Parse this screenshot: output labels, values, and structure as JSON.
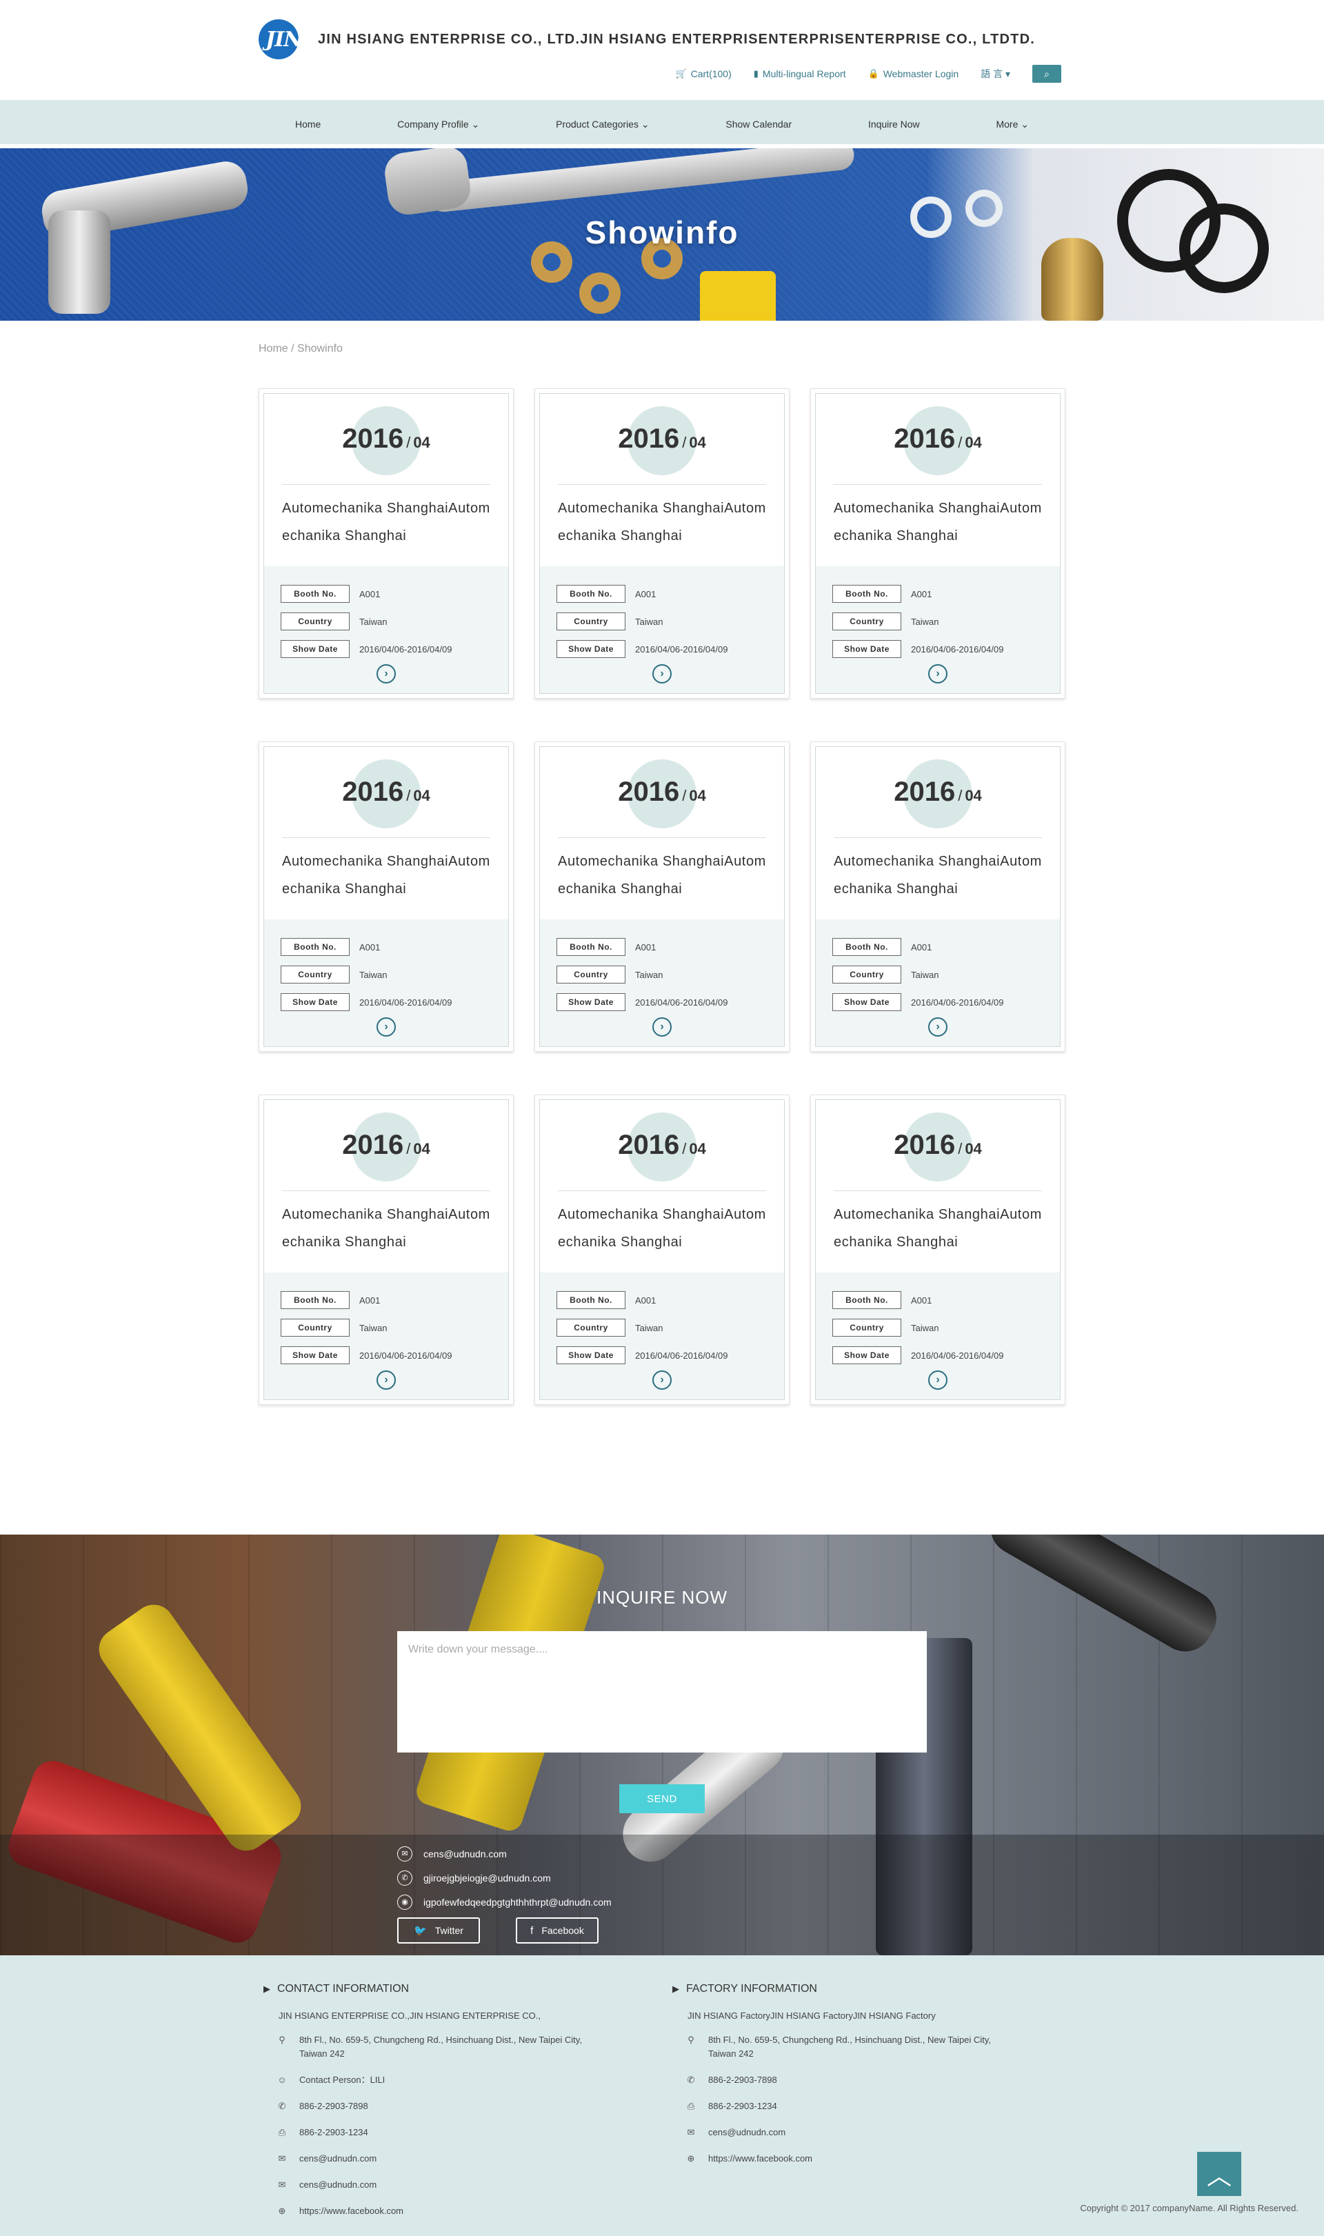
{
  "header": {
    "logo_text": "JIN",
    "company_name": "JIN HSIANG ENTERPRISE CO., LTD.JIN HSIANG ENTERPRISENTERPRISENTERPRISE CO., LTDTD.",
    "links": {
      "cart": "Cart(100)",
      "report": "Multi-lingual Report",
      "login": "Webmaster Login",
      "language": "語 言 ▾"
    }
  },
  "nav": {
    "items": [
      "Home",
      "Company Profile",
      "Product Categories",
      "Show Calendar",
      "Inquire Now",
      "More"
    ]
  },
  "banner": {
    "title": "Showinfo"
  },
  "breadcrumb": "Home / Showinfo",
  "labels": {
    "booth": "Booth No.",
    "country": "Country",
    "show_date": "Show Date"
  },
  "shows": [
    {
      "year": "2016",
      "sep": "/",
      "month": "04",
      "title": "Automechanika ShanghaiAutomechanika Shanghai",
      "booth": "A001",
      "country": "Taiwan",
      "date": "2016/04/06-2016/04/09"
    },
    {
      "year": "2016",
      "sep": "/",
      "month": "04",
      "title": "Automechanika ShanghaiAutomechanika Shanghai",
      "booth": "A001",
      "country": "Taiwan",
      "date": "2016/04/06-2016/04/09"
    },
    {
      "year": "2016",
      "sep": "/",
      "month": "04",
      "title": "Automechanika ShanghaiAutomechanika Shanghai",
      "booth": "A001",
      "country": "Taiwan",
      "date": "2016/04/06-2016/04/09"
    },
    {
      "year": "2016",
      "sep": "/",
      "month": "04",
      "title": "Automechanika ShanghaiAutomechanika Shanghai",
      "booth": "A001",
      "country": "Taiwan",
      "date": "2016/04/06-2016/04/09"
    },
    {
      "year": "2016",
      "sep": "/",
      "month": "04",
      "title": "Automechanika ShanghaiAutomechanika Shanghai",
      "booth": "A001",
      "country": "Taiwan",
      "date": "2016/04/06-2016/04/09"
    },
    {
      "year": "2016",
      "sep": "/",
      "month": "04",
      "title": "Automechanika ShanghaiAutomechanika Shanghai",
      "booth": "A001",
      "country": "Taiwan",
      "date": "2016/04/06-2016/04/09"
    },
    {
      "year": "2016",
      "sep": "/",
      "month": "04",
      "title": "Automechanika ShanghaiAutomechanika Shanghai",
      "booth": "A001",
      "country": "Taiwan",
      "date": "2016/04/06-2016/04/09"
    },
    {
      "year": "2016",
      "sep": "/",
      "month": "04",
      "title": "Automechanika ShanghaiAutomechanika Shanghai",
      "booth": "A001",
      "country": "Taiwan",
      "date": "2016/04/06-2016/04/09"
    },
    {
      "year": "2016",
      "sep": "/",
      "month": "04",
      "title": "Automechanika ShanghaiAutomechanika Shanghai",
      "booth": "A001",
      "country": "Taiwan",
      "date": "2016/04/06-2016/04/09"
    }
  ],
  "inquire": {
    "title": "INQUIRE NOW",
    "placeholder": "Write down your message....",
    "send": "SEND",
    "contacts": [
      {
        "icon": "mail-icon",
        "text": "cens@udnudn.com"
      },
      {
        "icon": "whatsapp-icon",
        "text": "gjiroejgbjeiogje@udnudn.com"
      },
      {
        "icon": "wechat-icon",
        "text": "igpofewfedqeedpgtghthhthrpt@udnudn.com"
      }
    ],
    "twitter": "Twitter",
    "facebook": "Facebook"
  },
  "footer": {
    "contact": {
      "heading": "CONTACT INFORMATION",
      "name": "JIN HSIANG ENTERPRISE CO.,JIN HSIANG ENTERPRISE CO.,",
      "address": "8th Fl., No. 659-5, Chungcheng Rd., Hsinchuang Dist., New Taipei City, Taiwan 242",
      "person": "Contact Person：LILI",
      "phone": "886-2-2903-7898",
      "fax": "886-2-2903-1234",
      "email1": "cens@udnudn.com",
      "email2": "cens@udnudn.com",
      "web": "https://www.facebook.com"
    },
    "factory": {
      "heading": "FACTORY INFORMATION",
      "name": "JIN HSIANG FactoryJIN HSIANG FactoryJIN HSIANG Factory",
      "address": "8th Fl., No. 659-5, Chungcheng Rd., Hsinchuang Dist., New Taipei City, Taiwan 242",
      "phone": "886-2-2903-7898",
      "fax": "886-2-2903-1234",
      "email": "cens@udnudn.com",
      "web": "https://www.facebook.com"
    },
    "copyright": "Copyright © 2017 companyName. All Rights Reserved."
  },
  "colors": {
    "accent": "#3f8c96",
    "nav_bg": "#d9e8e8",
    "send": "#4dd1d8",
    "banner_blue": "#2456a8"
  }
}
